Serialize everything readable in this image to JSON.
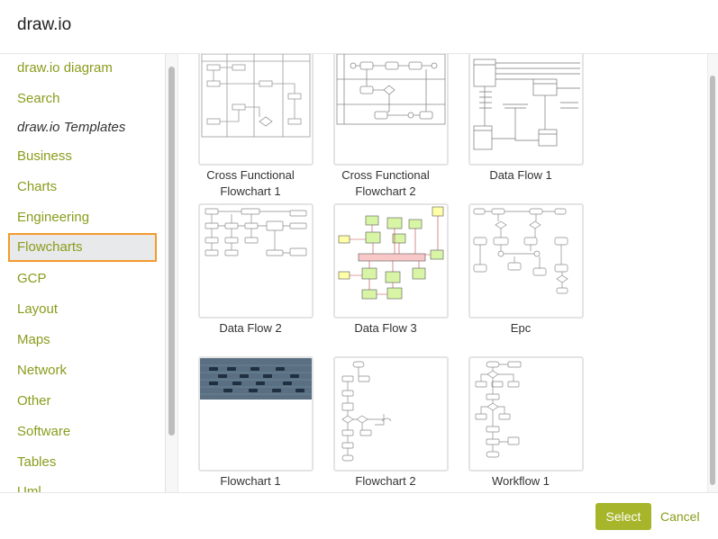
{
  "header": {
    "title": "draw.io"
  },
  "sidebar": {
    "items": [
      {
        "label": "draw.io diagram",
        "style": "link"
      },
      {
        "label": "Search",
        "style": "link"
      },
      {
        "label": "draw.io Templates",
        "style": "italic"
      },
      {
        "label": "Business",
        "style": "link"
      },
      {
        "label": "Charts",
        "style": "link"
      },
      {
        "label": "Engineering",
        "style": "link"
      },
      {
        "label": "Flowcharts",
        "style": "selected"
      },
      {
        "label": "GCP",
        "style": "link"
      },
      {
        "label": "Layout",
        "style": "link"
      },
      {
        "label": "Maps",
        "style": "link"
      },
      {
        "label": "Network",
        "style": "link"
      },
      {
        "label": "Other",
        "style": "link"
      },
      {
        "label": "Software",
        "style": "link"
      },
      {
        "label": "Tables",
        "style": "link"
      },
      {
        "label": "Uml",
        "style": "link"
      }
    ]
  },
  "templates": [
    {
      "label": "Cross Functional Flowchart 1",
      "line1": "Cross Functional",
      "line2": "Flowchart 1"
    },
    {
      "label": "Cross Functional Flowchart 2",
      "line1": "Cross Functional",
      "line2": "Flowchart 2"
    },
    {
      "label": "Data Flow 1",
      "line1": "Data Flow 1",
      "line2": ""
    },
    {
      "label": "Data Flow 2",
      "line1": "Data Flow 2",
      "line2": ""
    },
    {
      "label": "Data Flow 3",
      "line1": "Data Flow 3",
      "line2": ""
    },
    {
      "label": "Epc",
      "line1": "Epc",
      "line2": ""
    },
    {
      "label": "Flowchart 1",
      "line1": "Flowchart 1",
      "line2": ""
    },
    {
      "label": "Flowchart 2",
      "line1": "Flowchart 2",
      "line2": ""
    },
    {
      "label": "Workflow 1",
      "line1": "Workflow 1",
      "line2": ""
    }
  ],
  "footer": {
    "select_label": "Select",
    "cancel_label": "Cancel"
  },
  "colors": {
    "accent": "#a7b52b",
    "link": "#8a9c1c",
    "selection_border": "#f39a2b"
  }
}
